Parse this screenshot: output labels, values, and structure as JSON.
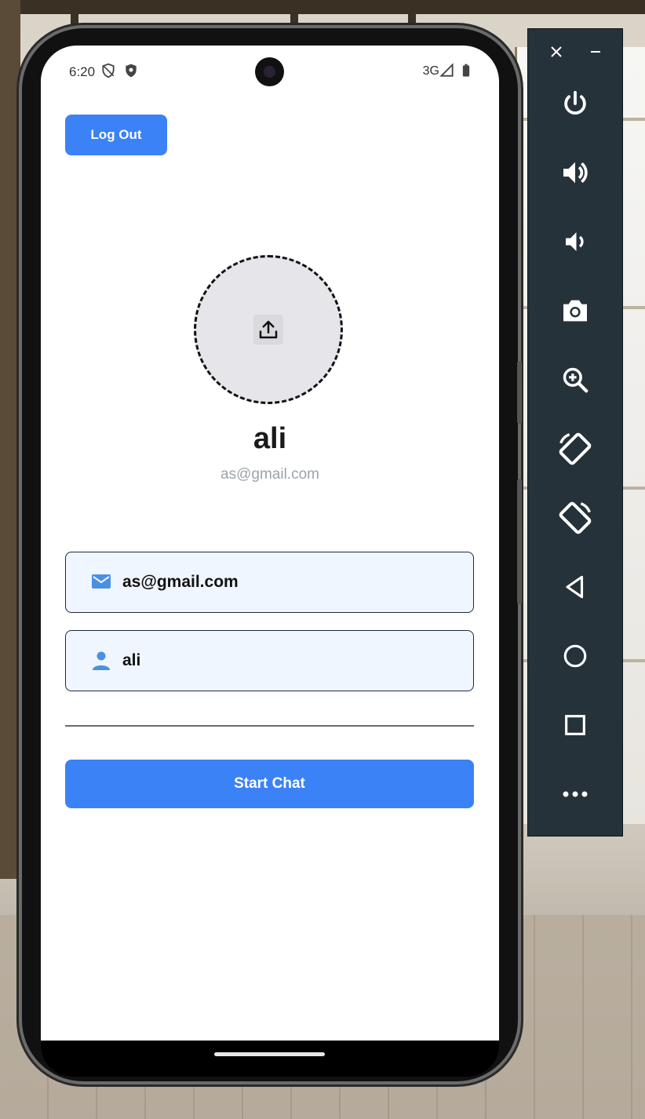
{
  "status_bar": {
    "time": "6:20",
    "network": "3G"
  },
  "header": {
    "logout_label": "Log Out"
  },
  "profile": {
    "name": "ali",
    "email": "as@gmail.com"
  },
  "fields": {
    "email_value": "as@gmail.com",
    "name_value": "ali"
  },
  "actions": {
    "start_chat_label": "Start Chat"
  },
  "colors": {
    "primary": "#3b82f6",
    "field_bg": "#eff6ff",
    "emulator_bg": "#26323a"
  },
  "emulator_controls": [
    "close-icon",
    "minimize-icon",
    "power-icon",
    "volume-up-icon",
    "volume-down-icon",
    "camera-icon",
    "zoom-icon",
    "rotate-left-icon",
    "rotate-right-icon",
    "back-icon",
    "home-icon",
    "overview-icon",
    "more-icon"
  ]
}
